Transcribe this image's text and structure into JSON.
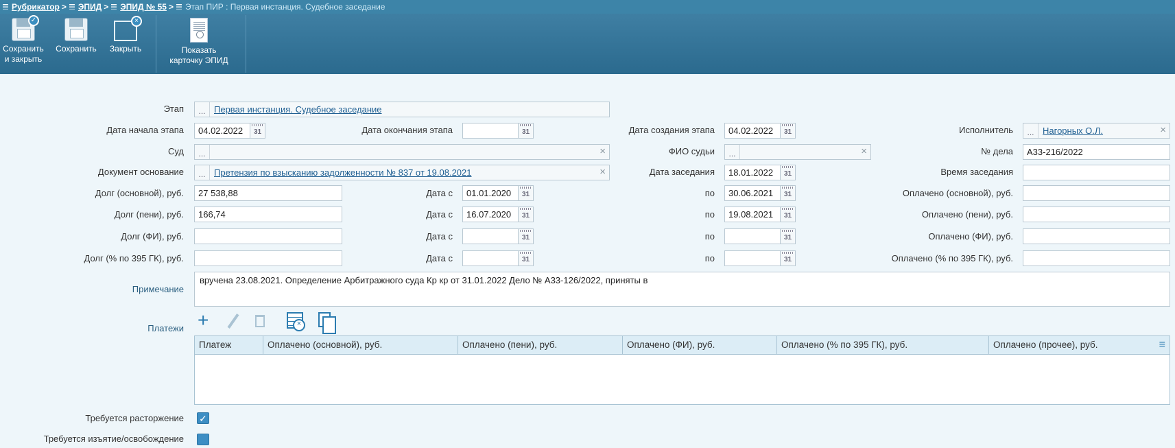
{
  "breadcrumb": {
    "items": [
      "Рубрикатор",
      "ЭПИД",
      "ЭПИД № 55"
    ],
    "separator": ">",
    "current": "Этап ПИР : Первая инстанция. Судебное заседание"
  },
  "toolbar": {
    "save_close": [
      "Сохранить",
      "и закрыть"
    ],
    "save": "Сохранить",
    "close": "Закрыть",
    "show_card": [
      "Показать",
      "карточку ЭПИД"
    ]
  },
  "form": {
    "stage_label": "Этап",
    "stage_value": "Первая инстанция. Судебное заседание",
    "start_label": "Дата начала этапа",
    "start_value": "04.02.2022",
    "end_label": "Дата окончания этапа",
    "end_value": "",
    "created_label": "Дата создания этапа",
    "created_value": "04.02.2022",
    "executor_label": "Исполнитель",
    "executor_value": "Нагорных О.Л.",
    "court_label": "Суд",
    "court_value": "",
    "judge_label": "ФИО судьи",
    "judge_value": "",
    "case_label": "№ дела",
    "case_value": "А33-216/2022",
    "basis_label": "Документ основание",
    "basis_value": "Претензия по взысканию задолженности № 837 от 19.08.2021",
    "session_date_label": "Дата заседания",
    "session_date_value": "18.01.2022",
    "session_time_label": "Время заседания",
    "session_time_value": "",
    "date_from_label": "Дата с",
    "to_label": "по",
    "rows": [
      {
        "debt_label": "Долг (основной), руб.",
        "debt": "27 538,88",
        "from": "01.01.2020",
        "to": "30.06.2021",
        "paid_label": "Оплачено (основной), руб.",
        "paid": ""
      },
      {
        "debt_label": "Долг (пени), руб.",
        "debt": "166,74",
        "from": "16.07.2020",
        "to": "19.08.2021",
        "paid_label": "Оплачено (пени), руб.",
        "paid": ""
      },
      {
        "debt_label": "Долг (ФИ), руб.",
        "debt": "",
        "from": "",
        "to": "",
        "paid_label": "Оплачено (ФИ), руб.",
        "paid": ""
      },
      {
        "debt_label": "Долг (% по 395 ГК), руб.",
        "debt": "",
        "from": "",
        "to": "",
        "paid_label": "Оплачено (% по 395 ГК), руб.",
        "paid": ""
      }
    ],
    "note_label": "Примечание",
    "note_value": "вручена 23.08.2021. Определение Арбитражного суда Кр кр от 31.01.2022 Дело № А33-126/2022, приняты в",
    "calendar_icon_text": "31",
    "dots_text": "...",
    "clear_text": "×"
  },
  "payments": {
    "label": "Платежи",
    "columns": [
      "Платеж",
      "Оплачено (основной), руб.",
      "Оплачено (пени), руб.",
      "Оплачено (ФИ), руб.",
      "Оплачено (% по 395 ГК), руб.",
      "Оплачено (прочее), руб."
    ],
    "plus_text": "+",
    "menu_text": "≡"
  },
  "checks": {
    "termination_label": "Требуется расторжение",
    "termination_checked": true,
    "seizure_label": "Требуется изъятие/освобождение",
    "seizure_checked": false,
    "check_mark": "✓"
  }
}
